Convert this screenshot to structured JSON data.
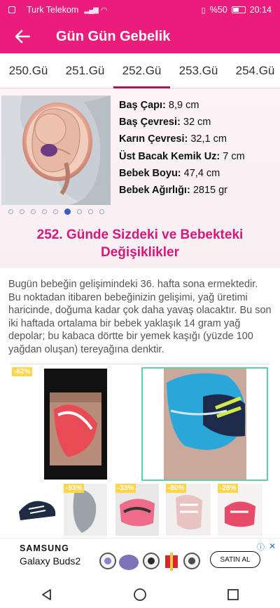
{
  "status_bar": {
    "carrier": "Turk Telekom",
    "battery": "%50",
    "time": "20:14"
  },
  "appbar": {
    "title": "Gün Gün Gebelik"
  },
  "tabs": [
    {
      "label": "250.Gü"
    },
    {
      "label": "251.Gü"
    },
    {
      "label": "252.Gü"
    },
    {
      "label": "253.Gü"
    },
    {
      "label": "254.Gü"
    }
  ],
  "active_tab": 2,
  "measurements": [
    {
      "key": "Baş Çapı:",
      "value": "8,9 cm"
    },
    {
      "key": "Baş Çevresi:",
      "value": "32 cm"
    },
    {
      "key": "Karın Çevresi:",
      "value": "32,1 cm"
    },
    {
      "key": "Üst Bacak Kemik Uz:",
      "value": "7 cm"
    },
    {
      "key": "Bebek Boyu:",
      "value": "47,4 cm"
    },
    {
      "key": "Bebek Ağırlığı:",
      "value": "2815 gr"
    }
  ],
  "carousel": {
    "count": 9,
    "active": 5
  },
  "heading": "252. Günde Sizdeki ve Bebekteki Değişiklikler",
  "article_text": "Bugün bebeğin gelişimindeki 36. hafta sona ermektedir. Bu noktadan itibaren bebeğinizin gelişimi, yağ üretimi haricinde, doğuma kadar çok daha yavaş olacaktır. Bu son iki haftada ortalama bir bebek yaklaşık 14 gram yağ depolar; bu kabaca dörtte bir yemek kaşığı (yüzde 100 yağdan oluşan) tereyağına denktir.",
  "ad_products": {
    "main_badge": "-62%",
    "badges": [
      "",
      "-93%",
      "-33%",
      "-80%",
      "-28%"
    ]
  },
  "banner": {
    "brand": "SAMSUNG",
    "product": "Galaxy Buds2",
    "cta": "SATIN AL"
  },
  "colors": {
    "primary": "#ec1c7c",
    "heading": "#d8177a",
    "tab_indicator": "#b0154f"
  }
}
